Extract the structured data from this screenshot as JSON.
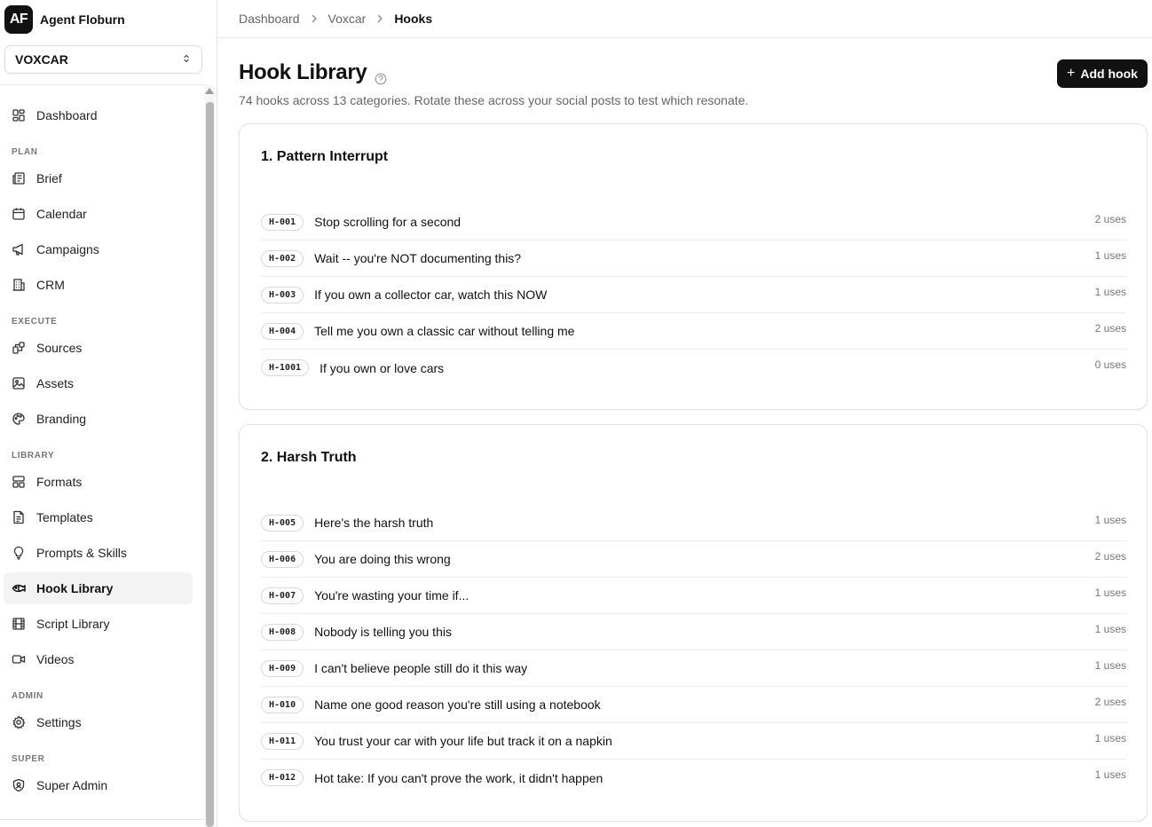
{
  "brand": {
    "logo": "AF",
    "name": "Agent Floburn"
  },
  "workspace": {
    "name": "VOXCAR",
    "icon": "chevron-up-down-icon"
  },
  "nav": {
    "dashboard": "Dashboard",
    "sections": {
      "plan": "PLAN",
      "execute": "EXECUTE",
      "library": "LIBRARY",
      "admin": "ADMIN",
      "super": "SUPER"
    },
    "items": {
      "brief": "Brief",
      "calendar": "Calendar",
      "campaigns": "Campaigns",
      "crm": "CRM",
      "sources": "Sources",
      "assets": "Assets",
      "branding": "Branding",
      "formats": "Formats",
      "templates": "Templates",
      "prompts": "Prompts & Skills",
      "hook_library": "Hook Library",
      "script_library": "Script Library",
      "videos": "Videos",
      "settings": "Settings",
      "super_admin": "Super Admin"
    },
    "active": "Hook Library"
  },
  "breadcrumb": [
    "Dashboard",
    "Voxcar",
    "Hooks"
  ],
  "page": {
    "title": "Hook Library",
    "subtitle": "74 hooks across 13 categories. Rotate these across your social posts to test which resonate.",
    "add_button": "Add hook"
  },
  "categories": [
    {
      "title": "1. Pattern Interrupt",
      "hooks": [
        {
          "code": "H-001",
          "text": "Stop scrolling for a second",
          "uses": "2 uses"
        },
        {
          "code": "H-002",
          "text": "Wait -- you're NOT documenting this?",
          "uses": "1 uses"
        },
        {
          "code": "H-003",
          "text": "If you own a collector car, watch this NOW",
          "uses": "1 uses"
        },
        {
          "code": "H-004",
          "text": "Tell me you own a classic car without telling me",
          "uses": "2 uses"
        },
        {
          "code": "H-1001",
          "text": "If you own or love cars",
          "uses": "0 uses"
        }
      ]
    },
    {
      "title": "2. Harsh Truth",
      "hooks": [
        {
          "code": "H-005",
          "text": "Here's the harsh truth",
          "uses": "1 uses"
        },
        {
          "code": "H-006",
          "text": "You are doing this wrong",
          "uses": "2 uses"
        },
        {
          "code": "H-007",
          "text": "You're wasting your time if...",
          "uses": "1 uses"
        },
        {
          "code": "H-008",
          "text": "Nobody is telling you this",
          "uses": "1 uses"
        },
        {
          "code": "H-009",
          "text": "I can't believe people still do it this way",
          "uses": "1 uses"
        },
        {
          "code": "H-010",
          "text": "Name one good reason you're still using a notebook",
          "uses": "2 uses"
        },
        {
          "code": "H-011",
          "text": "You trust your car with your life but track it on a napkin",
          "uses": "1 uses"
        },
        {
          "code": "H-012",
          "text": "Hot take: If you can't prove the work, it didn't happen",
          "uses": "1 uses"
        }
      ]
    }
  ]
}
